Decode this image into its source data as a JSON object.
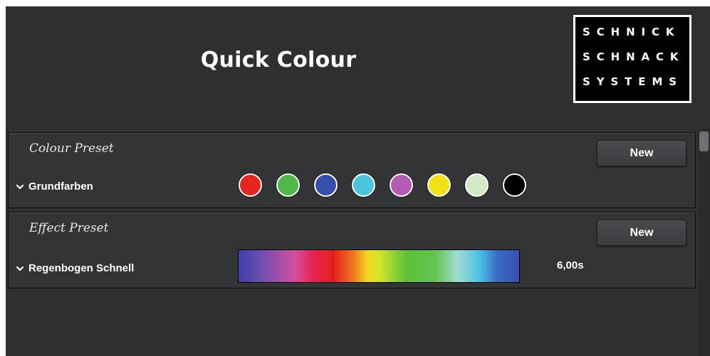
{
  "window": {
    "title": "Quick Colour"
  },
  "logo": {
    "lines": [
      "SCHNICK",
      "SCHNACK",
      "SYSTEMS"
    ]
  },
  "colour_preset": {
    "header": "Colour Preset",
    "new_label": "New",
    "preset_name": "Grundfarben",
    "expand_icon": "chevron-down-icon",
    "swatches": [
      {
        "name": "red",
        "color": "#e8241f"
      },
      {
        "name": "green",
        "color": "#4fb848"
      },
      {
        "name": "blue",
        "color": "#3550aa"
      },
      {
        "name": "cyan",
        "color": "#4cc3df"
      },
      {
        "name": "magenta",
        "color": "#b45bb5"
      },
      {
        "name": "yellow",
        "color": "#f1e116"
      },
      {
        "name": "pale-green",
        "color": "#d2e9c8"
      },
      {
        "name": "black",
        "color": "#000000"
      }
    ]
  },
  "effect_preset": {
    "header": "Effect Preset",
    "new_label": "New",
    "preset_name": "Regenbogen Schnell",
    "expand_icon": "chevron-down-icon",
    "duration": "6,00s"
  },
  "colors": {
    "background": "#2e2f31",
    "panel": "#333436",
    "text": "#ffffff"
  }
}
